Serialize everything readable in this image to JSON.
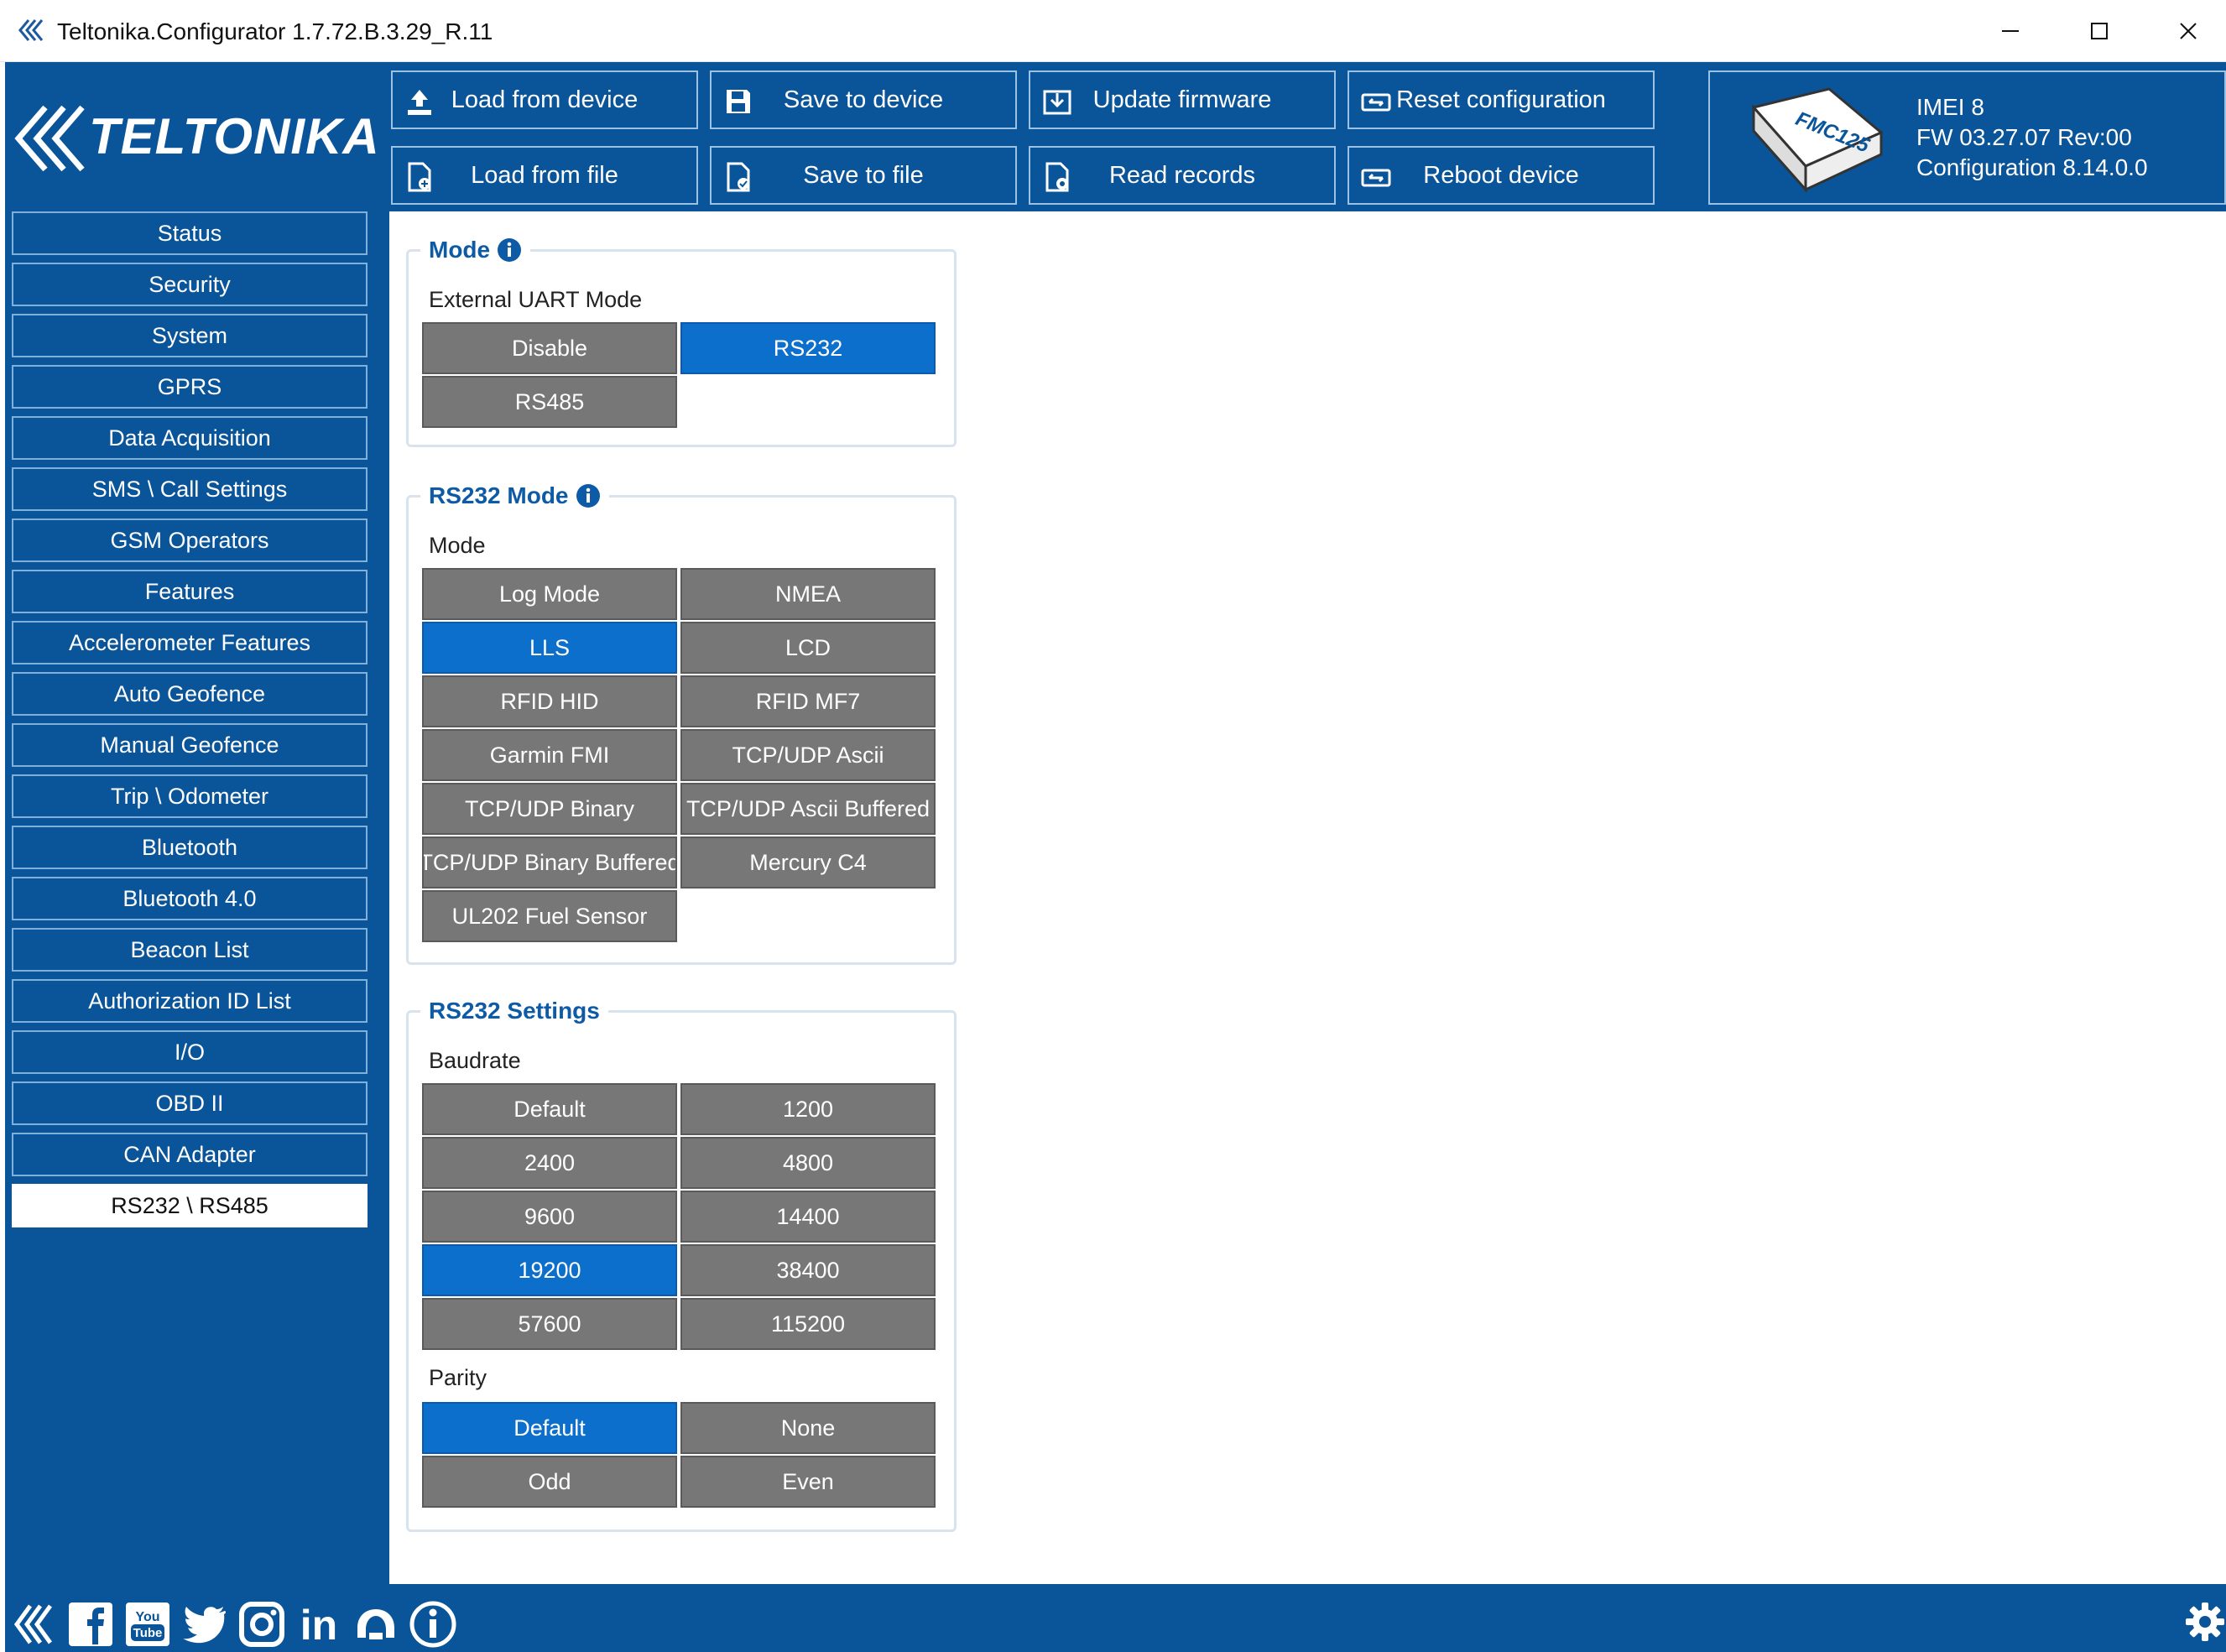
{
  "window": {
    "title": "Teltonika.Configurator 1.7.72.B.3.29_R.11"
  },
  "brand": {
    "logo_text": "TELTONIKA",
    "accent": "#0a5499",
    "selected": "#0d6fcc",
    "option_bg": "#777777"
  },
  "toolbar": {
    "load_from_device": "Load from device",
    "save_to_device": "Save to device",
    "update_firmware": "Update firmware",
    "reset_configuration": "Reset configuration",
    "load_from_file": "Load from file",
    "save_to_file": "Save to file",
    "read_records": "Read records",
    "reboot_device": "Reboot device"
  },
  "device": {
    "model_label": "FMC125",
    "imei": "IMEI  8",
    "fw": "FW  03.27.07 Rev:00",
    "configuration": "Configuration  8.14.0.0"
  },
  "sidebar": {
    "items": [
      {
        "label": "Status"
      },
      {
        "label": "Security"
      },
      {
        "label": "System"
      },
      {
        "label": "GPRS"
      },
      {
        "label": "Data Acquisition"
      },
      {
        "label": "SMS \\ Call Settings"
      },
      {
        "label": "GSM Operators"
      },
      {
        "label": "Features"
      },
      {
        "label": "Accelerometer Features"
      },
      {
        "label": "Auto Geofence"
      },
      {
        "label": "Manual Geofence"
      },
      {
        "label": "Trip \\ Odometer"
      },
      {
        "label": "Bluetooth"
      },
      {
        "label": "Bluetooth 4.0"
      },
      {
        "label": "Beacon List"
      },
      {
        "label": "Authorization ID List"
      },
      {
        "label": "I/O"
      },
      {
        "label": "OBD II"
      },
      {
        "label": "CAN Adapter"
      },
      {
        "label": "RS232 \\ RS485"
      }
    ],
    "active": "RS232 \\ RS485"
  },
  "mode_group": {
    "title": "Mode",
    "field": "External UART Mode",
    "options": [
      "Disable",
      "RS232",
      "RS485"
    ],
    "selected": "RS232"
  },
  "rs232_mode_group": {
    "title": "RS232 Mode",
    "field": "Mode",
    "options": [
      "Log Mode",
      "NMEA",
      "LLS",
      "LCD",
      "RFID HID",
      "RFID MF7",
      "Garmin FMI",
      "TCP/UDP Ascii",
      "TCP/UDP Binary",
      "TCP/UDP Ascii Buffered",
      "TCP/UDP Binary Buffered",
      "Mercury C4",
      "UL202 Fuel Sensor"
    ],
    "selected": "LLS"
  },
  "rs232_settings_group": {
    "title": "RS232 Settings",
    "baudrate_label": "Baudrate",
    "baudrate_options": [
      "Default",
      "1200",
      "2400",
      "4800",
      "9600",
      "14400",
      "19200",
      "38400",
      "57600",
      "115200"
    ],
    "baudrate_selected": "19200",
    "parity_label": "Parity",
    "parity_options": [
      "Default",
      "None",
      "Odd",
      "Even"
    ],
    "parity_selected": "Default"
  },
  "footer": {
    "icons": [
      "teltonika-icon",
      "facebook-icon",
      "youtube-icon",
      "twitter-icon",
      "instagram-icon",
      "linkedin-icon",
      "support-chat-icon",
      "info-icon",
      "settings-gear-icon"
    ],
    "youtube_text": "You Tube",
    "linkedin_text": "in"
  }
}
